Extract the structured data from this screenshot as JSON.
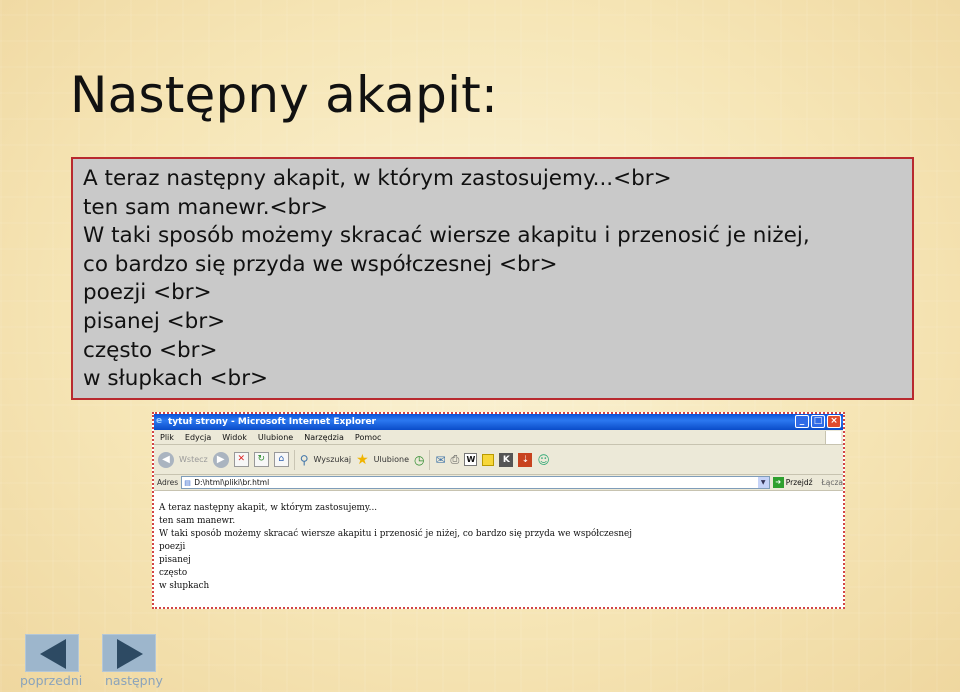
{
  "slide": {
    "title": "Następny akapit:"
  },
  "code_box": {
    "lines": [
      "A teraz następny akapit, w którym zastosujemy...<br>",
      "ten sam manewr.<br>",
      "W taki sposób możemy skracać wiersze akapitu i przenosić je niżej,",
      "co bardzo się przyda we współczesnej <br>",
      "poezji <br>",
      "pisanej <br>",
      "często <br>",
      "w słupkach <br>"
    ]
  },
  "browser": {
    "title": "tytuł strony - Microsoft Internet Explorer",
    "menu": [
      "Plik",
      "Edycja",
      "Widok",
      "Ulubione",
      "Narzędzia",
      "Pomoc"
    ],
    "toolbar": {
      "back_label": "Wstecz",
      "search_label": "Wyszukaj",
      "favorites_label": "Ulubione"
    },
    "address": {
      "label": "Adres",
      "value": "D:\\html\\pliki\\br.html",
      "go_label": "Przejdź",
      "links_label": "Łącza"
    },
    "content_lines": [
      "A teraz następny akapit, w którym zastosujemy...",
      "ten sam manewr.",
      "W taki sposób możemy skracać wiersze akapitu i przenosić je niżej, co bardzo się przyda we współczesnej",
      "poezji",
      "pisanej",
      "często",
      "w słupkach"
    ]
  },
  "nav": {
    "prev_label": "poprzedni",
    "next_label": "następny"
  },
  "colors": {
    "box_border": "#b8292f",
    "box_bg": "#c9c9c9",
    "nav_button": "#9db6cc",
    "nav_arrow": "#2d4a63"
  }
}
